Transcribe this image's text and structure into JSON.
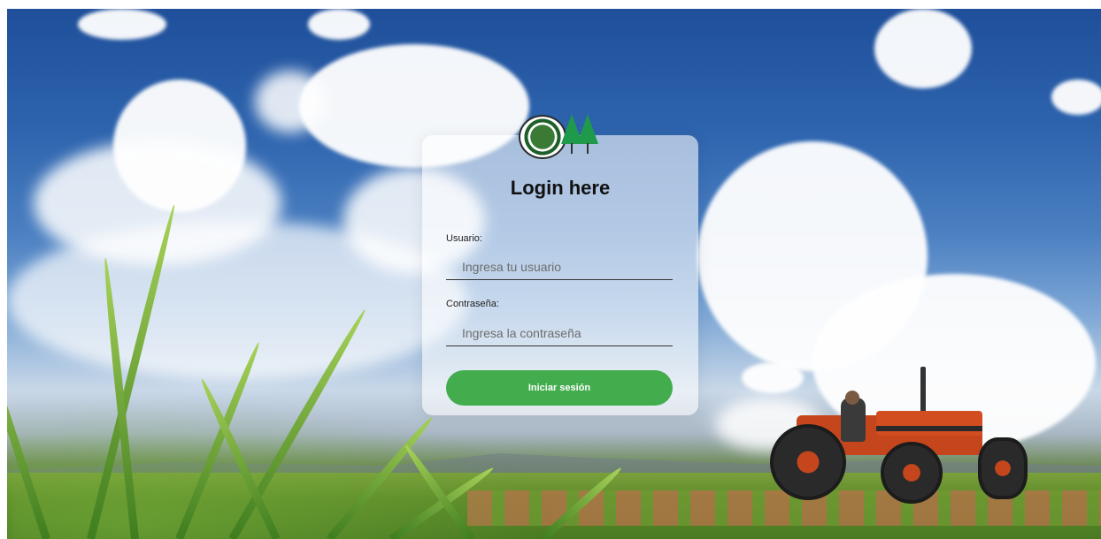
{
  "card": {
    "title": "Login here",
    "logo_icon": "institution-seal-and-pine-trees-logo"
  },
  "form": {
    "username_label": "Usuario:",
    "username_placeholder": "Ingresa tu usuario",
    "username_value": "",
    "password_label": "Contraseña:",
    "password_placeholder": "Ingresa la contraseña",
    "password_value": "",
    "submit_label": "Iniciar sesión"
  },
  "colors": {
    "button": "#43ad4e",
    "logo_trees": "#1f9a4a"
  },
  "background": {
    "scene": "farm-field-with-tractor-under-cloudy-sky"
  }
}
